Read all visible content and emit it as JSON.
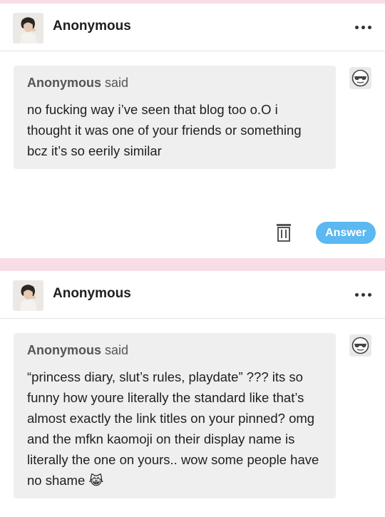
{
  "posts": [
    {
      "blog_name": "Anonymous",
      "ask": {
        "asker": "Anonymous",
        "said": "said",
        "text": "no fucking way i’ve seen that blog too o.O i thought it was one of your friends or something bcz it’s so eerily similar"
      },
      "footer": {
        "answer_label": "Answer"
      }
    },
    {
      "blog_name": "Anonymous",
      "ask": {
        "asker": "Anonymous",
        "said": "said",
        "text": "“princess diary, slut’s rules, playdate” ??? its so funny how youre literally the standard like that’s almost exactly the link titles on your pinned? omg and the mfkn kaomoji on their display name is literally the one on yours.. wow some people have no shame",
        "emoji": "😹"
      }
    }
  ],
  "colors": {
    "pink_divider": "#f8dde6",
    "ask_background": "#efefef",
    "answer_button": "#5bb8f0"
  },
  "icons": {
    "more": "more-horizontal-icon",
    "anon": "anonymous-sunglasses-icon",
    "delete": "trash-icon"
  }
}
